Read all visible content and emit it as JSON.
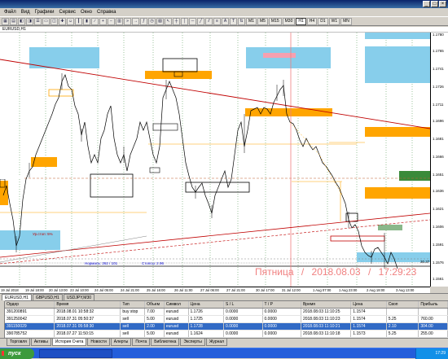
{
  "window": {
    "title": "",
    "controls": [
      "_",
      "□",
      "×"
    ]
  },
  "menu": [
    "Файл",
    "Вид",
    "Графики",
    "Сервис",
    "Окно",
    "Справка"
  ],
  "timeframes": [
    "M1",
    "M5",
    "M15",
    "M30",
    "H1",
    "H4",
    "D1",
    "W1",
    "MN"
  ],
  "active_timeframe": "H1",
  "chart": {
    "tab_title": "EURUSD,H1",
    "watermark_day": "Пятница",
    "watermark_date": "2018.08.03",
    "watermark_time": "17:29:23",
    "annotation_levels": "Нормаль: 262 / 101",
    "annotation_stop": "Стопсы: 2.96",
    "annotation_left": "Ур.стоп: 5%",
    "annotation_right": "30.37",
    "colors": {
      "orange": "#ffa500",
      "cyan": "#87ceeb",
      "green": "#3a8a3a",
      "pink": "#f08080",
      "trend_red": "#c00000"
    },
    "price_labels": [
      "1.1780",
      "1.1765",
      "1.1741",
      "1.1726",
      "1.1711",
      "1.1696",
      "1.1681",
      "1.1666",
      "1.1651",
      "1.1636",
      "1.1621",
      "1.1606",
      "1.1591",
      "1.1576",
      "1.1561"
    ],
    "time_labels": [
      "19 Jul 2018",
      "19 Jul 18:00",
      "20 Jul 13:00",
      "23 Jul 10:00",
      "24 Jul 05:00",
      "24 Jul 21:00",
      "25 Jul 16:00",
      "26 Jul 11:00",
      "27 Jul 06:00",
      "27 Jul 21:00",
      "30 Jul 17:00",
      "31 Jul 12:00",
      "1 Aug 07:00",
      "1 Aug 23:00",
      "2 Aug 18:00",
      "3 Aug 13:00"
    ]
  },
  "symbol_tabs": [
    "EURUSD,H1",
    "GBPUSD,H1",
    "USDJPY,M30"
  ],
  "active_symbol_tab": "EURUSD,H1",
  "terminal": {
    "columns": [
      "Ордер",
      "Время",
      "Тип",
      "Объем",
      "Символ",
      "Цена",
      "S / L",
      "T / P",
      "Время",
      "Цена",
      "Своп",
      "Прибыль"
    ],
    "rows": [
      [
        "391200891",
        "2018.08.01 10:58:32",
        "buy stop",
        "7.00",
        "eurusd",
        "1.1726",
        "0.0000",
        "0.0000",
        "2018.08.03 11:10:25",
        "1.1574",
        "",
        ""
      ],
      [
        "391250042",
        "2018.07.31 05:50:37",
        "sell",
        "5.00",
        "eurusd",
        "1.1725",
        "0.0000",
        "0.0000",
        "2018.08.03 11:10:23",
        "1.1574",
        "5.25",
        "760.00"
      ],
      [
        "391150029",
        "2018.07.31 05:58:30",
        "sell",
        "2.00",
        "eurusd",
        "1.1728",
        "0.0000",
        "0.0000",
        "2018.08.03 11:10:21",
        "1.1574",
        "2.10",
        "304.00"
      ],
      [
        "390785752",
        "2018.07.27 11:50:15",
        "sell",
        "5.00",
        "eurusd",
        "1.1624",
        "0.0000",
        "0.0000",
        "2018.08.03 11:10:18",
        "1.1573",
        "5.25",
        "255.00"
      ]
    ],
    "selected_row": 2
  },
  "bottom_tabs": [
    "Торговля",
    "Активы",
    "История Счета",
    "Новости",
    "Алерты",
    "Почта",
    "Библиотека",
    "Эксперты",
    "Журнал"
  ],
  "active_bottom_tab": "История Счета",
  "taskbar": {
    "start_label": "пуск",
    "app_label": "",
    "clock": "17:29"
  }
}
